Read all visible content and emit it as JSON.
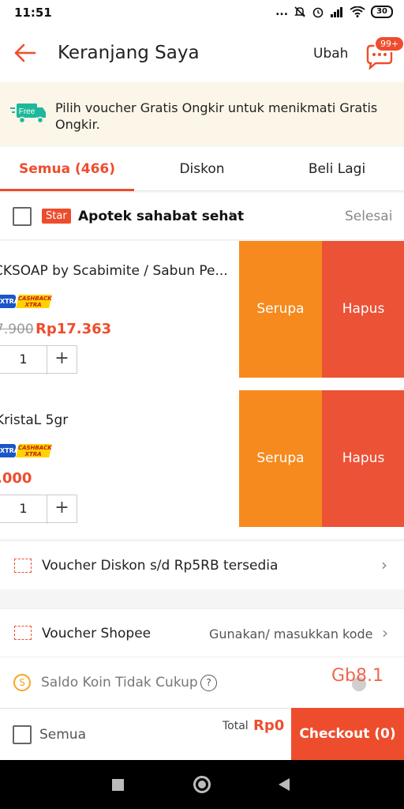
{
  "status_bar": {
    "time": "11:51",
    "signal": "...",
    "battery": "30"
  },
  "header": {
    "title": "Keranjang Saya",
    "edit_label": "Ubah",
    "chat_badge": "99+"
  },
  "banner": {
    "icon_label": "Free",
    "text": "Pilih voucher Gratis Ongkir untuk menikmati Gratis Ongkir."
  },
  "tabs": [
    {
      "label": "Semua (466)",
      "active": true
    },
    {
      "label": "Diskon",
      "active": false
    },
    {
      "label": "Beli Lagi",
      "active": false
    }
  ],
  "shop": {
    "badge": "Star",
    "name": "Apotek sahabat sehat",
    "action": "Selesai"
  },
  "items": [
    {
      "title": "CKSOAP by Scabimite / Sabun Pe...",
      "badge_xtra": "XTRA",
      "badge_cashback": "CASHBACK XTRA",
      "old_price": "7.900",
      "price": "Rp17.363",
      "quantity": "1",
      "similar_label": "Serupa",
      "delete_label": "Hapus"
    },
    {
      "title": "KristaL 5gr",
      "badge_xtra": "XTRA",
      "badge_cashback": "CASHBACK XTRA",
      "old_price": "",
      "price": ".000",
      "quantity": "1",
      "similar_label": "Serupa",
      "delete_label": "Hapus"
    }
  ],
  "shop_voucher": {
    "text": "Voucher Diskon s/d Rp5RB tersedia"
  },
  "shopee_voucher": {
    "label": "Voucher Shopee",
    "action": "Gunakan/ masukkan kode"
  },
  "coins": {
    "icon": "S",
    "label": "Saldo Koin Tidak Cukup",
    "help": "?",
    "overlay": "Gb8.1"
  },
  "footer": {
    "select_all": "Semua",
    "total_label": "Total",
    "total_value": "Rp0",
    "checkout_label": "Checkout (0)"
  },
  "colors": {
    "accent": "#ee4d2d",
    "similar": "#f68a1e",
    "delete": "#ec5236",
    "banner_bg": "#fcf6e8"
  }
}
